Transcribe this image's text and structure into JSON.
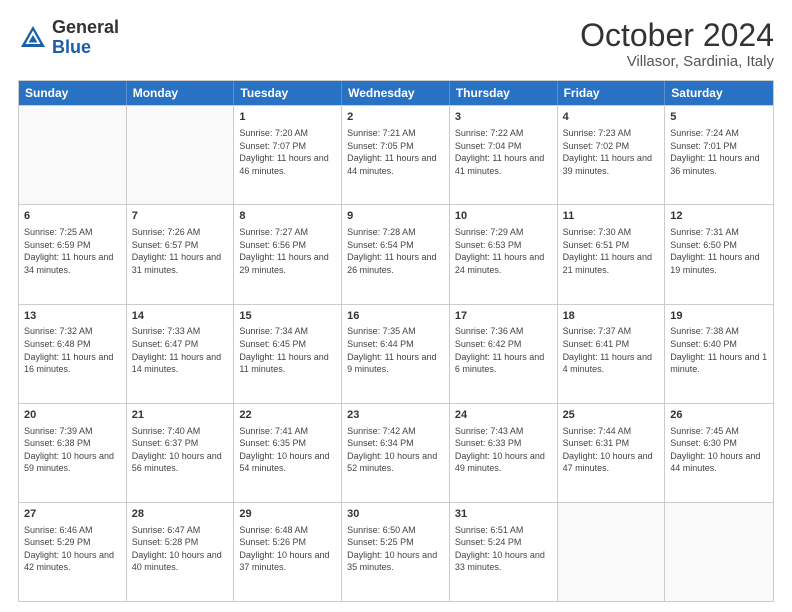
{
  "header": {
    "logo_general": "General",
    "logo_blue": "Blue",
    "month_title": "October 2024",
    "location": "Villasor, Sardinia, Italy"
  },
  "weekdays": [
    "Sunday",
    "Monday",
    "Tuesday",
    "Wednesday",
    "Thursday",
    "Friday",
    "Saturday"
  ],
  "rows": [
    [
      {
        "day": "",
        "info": ""
      },
      {
        "day": "",
        "info": ""
      },
      {
        "day": "1",
        "info": "Sunrise: 7:20 AM\nSunset: 7:07 PM\nDaylight: 11 hours and 46 minutes."
      },
      {
        "day": "2",
        "info": "Sunrise: 7:21 AM\nSunset: 7:05 PM\nDaylight: 11 hours and 44 minutes."
      },
      {
        "day": "3",
        "info": "Sunrise: 7:22 AM\nSunset: 7:04 PM\nDaylight: 11 hours and 41 minutes."
      },
      {
        "day": "4",
        "info": "Sunrise: 7:23 AM\nSunset: 7:02 PM\nDaylight: 11 hours and 39 minutes."
      },
      {
        "day": "5",
        "info": "Sunrise: 7:24 AM\nSunset: 7:01 PM\nDaylight: 11 hours and 36 minutes."
      }
    ],
    [
      {
        "day": "6",
        "info": "Sunrise: 7:25 AM\nSunset: 6:59 PM\nDaylight: 11 hours and 34 minutes."
      },
      {
        "day": "7",
        "info": "Sunrise: 7:26 AM\nSunset: 6:57 PM\nDaylight: 11 hours and 31 minutes."
      },
      {
        "day": "8",
        "info": "Sunrise: 7:27 AM\nSunset: 6:56 PM\nDaylight: 11 hours and 29 minutes."
      },
      {
        "day": "9",
        "info": "Sunrise: 7:28 AM\nSunset: 6:54 PM\nDaylight: 11 hours and 26 minutes."
      },
      {
        "day": "10",
        "info": "Sunrise: 7:29 AM\nSunset: 6:53 PM\nDaylight: 11 hours and 24 minutes."
      },
      {
        "day": "11",
        "info": "Sunrise: 7:30 AM\nSunset: 6:51 PM\nDaylight: 11 hours and 21 minutes."
      },
      {
        "day": "12",
        "info": "Sunrise: 7:31 AM\nSunset: 6:50 PM\nDaylight: 11 hours and 19 minutes."
      }
    ],
    [
      {
        "day": "13",
        "info": "Sunrise: 7:32 AM\nSunset: 6:48 PM\nDaylight: 11 hours and 16 minutes."
      },
      {
        "day": "14",
        "info": "Sunrise: 7:33 AM\nSunset: 6:47 PM\nDaylight: 11 hours and 14 minutes."
      },
      {
        "day": "15",
        "info": "Sunrise: 7:34 AM\nSunset: 6:45 PM\nDaylight: 11 hours and 11 minutes."
      },
      {
        "day": "16",
        "info": "Sunrise: 7:35 AM\nSunset: 6:44 PM\nDaylight: 11 hours and 9 minutes."
      },
      {
        "day": "17",
        "info": "Sunrise: 7:36 AM\nSunset: 6:42 PM\nDaylight: 11 hours and 6 minutes."
      },
      {
        "day": "18",
        "info": "Sunrise: 7:37 AM\nSunset: 6:41 PM\nDaylight: 11 hours and 4 minutes."
      },
      {
        "day": "19",
        "info": "Sunrise: 7:38 AM\nSunset: 6:40 PM\nDaylight: 11 hours and 1 minute."
      }
    ],
    [
      {
        "day": "20",
        "info": "Sunrise: 7:39 AM\nSunset: 6:38 PM\nDaylight: 10 hours and 59 minutes."
      },
      {
        "day": "21",
        "info": "Sunrise: 7:40 AM\nSunset: 6:37 PM\nDaylight: 10 hours and 56 minutes."
      },
      {
        "day": "22",
        "info": "Sunrise: 7:41 AM\nSunset: 6:35 PM\nDaylight: 10 hours and 54 minutes."
      },
      {
        "day": "23",
        "info": "Sunrise: 7:42 AM\nSunset: 6:34 PM\nDaylight: 10 hours and 52 minutes."
      },
      {
        "day": "24",
        "info": "Sunrise: 7:43 AM\nSunset: 6:33 PM\nDaylight: 10 hours and 49 minutes."
      },
      {
        "day": "25",
        "info": "Sunrise: 7:44 AM\nSunset: 6:31 PM\nDaylight: 10 hours and 47 minutes."
      },
      {
        "day": "26",
        "info": "Sunrise: 7:45 AM\nSunset: 6:30 PM\nDaylight: 10 hours and 44 minutes."
      }
    ],
    [
      {
        "day": "27",
        "info": "Sunrise: 6:46 AM\nSunset: 5:29 PM\nDaylight: 10 hours and 42 minutes."
      },
      {
        "day": "28",
        "info": "Sunrise: 6:47 AM\nSunset: 5:28 PM\nDaylight: 10 hours and 40 minutes."
      },
      {
        "day": "29",
        "info": "Sunrise: 6:48 AM\nSunset: 5:26 PM\nDaylight: 10 hours and 37 minutes."
      },
      {
        "day": "30",
        "info": "Sunrise: 6:50 AM\nSunset: 5:25 PM\nDaylight: 10 hours and 35 minutes."
      },
      {
        "day": "31",
        "info": "Sunrise: 6:51 AM\nSunset: 5:24 PM\nDaylight: 10 hours and 33 minutes."
      },
      {
        "day": "",
        "info": ""
      },
      {
        "day": "",
        "info": ""
      }
    ]
  ]
}
